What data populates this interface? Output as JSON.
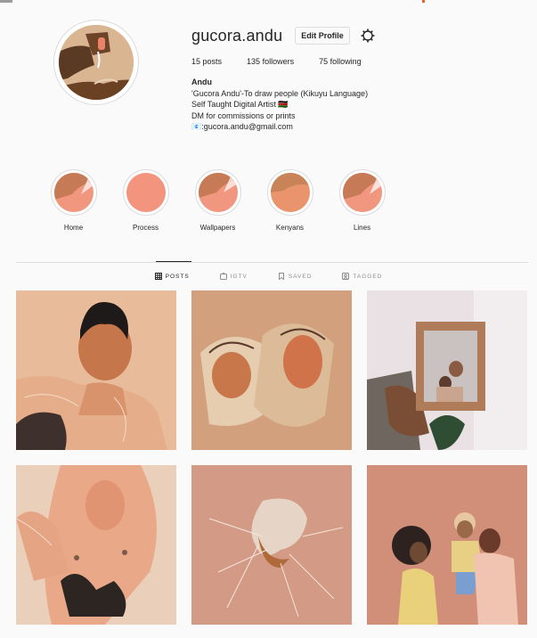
{
  "profile": {
    "username": "gucora.andu",
    "edit_label": "Edit Profile",
    "stats": [
      {
        "value": "15",
        "label": "posts"
      },
      {
        "value": "135",
        "label": "followers"
      },
      {
        "value": "75",
        "label": "following"
      }
    ],
    "bio": {
      "name": "Andu",
      "lines": [
        "'Gucora Andu'-To draw people (Kikuyu Language)",
        "Self Taught Digital Artist 🇰🇪",
        "DM for commissions or prints",
        "📧:gucora.andu@gmail.com"
      ]
    }
  },
  "highlights": [
    {
      "label": "Home"
    },
    {
      "label": "Process"
    },
    {
      "label": "Wallpapers"
    },
    {
      "label": "Kenyans"
    },
    {
      "label": "Lines"
    }
  ],
  "tabs": [
    {
      "label": "POSTS",
      "icon": "grid-icon"
    },
    {
      "label": "IGTV",
      "icon": "tv-icon"
    },
    {
      "label": "SAVED",
      "icon": "bookmark-icon"
    },
    {
      "label": "TAGGED",
      "icon": "tag-icon"
    }
  ],
  "colors": {
    "accent_peach": "#f1967f",
    "skin_brown": "#b2693f",
    "bg": "#fafafa"
  }
}
